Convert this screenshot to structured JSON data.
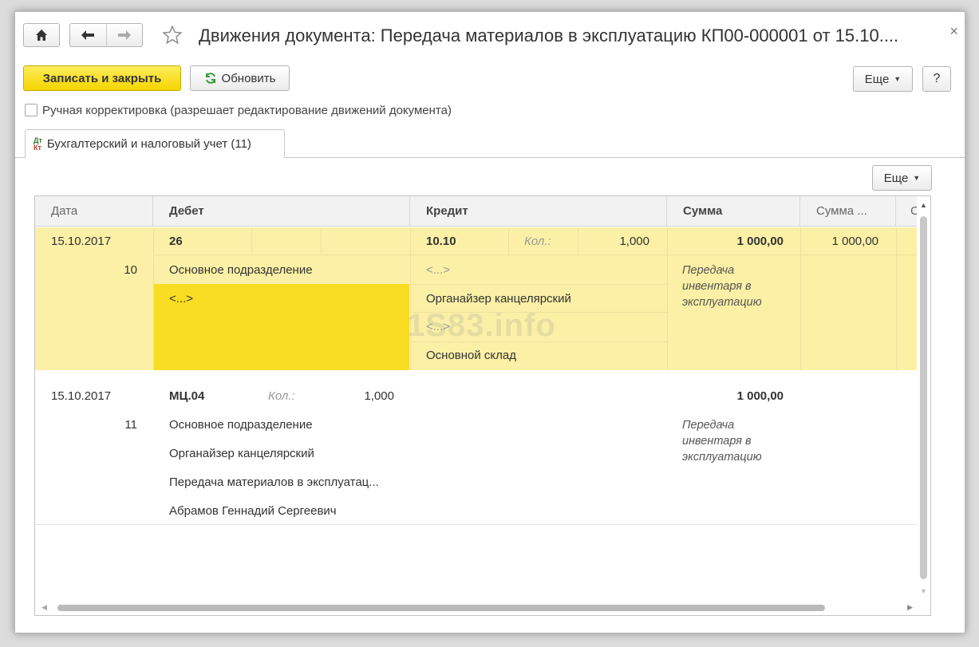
{
  "window": {
    "title": "Движения документа: Передача материалов в эксплуатацию КП00-000001 от 15.10....",
    "close_glyph": "×"
  },
  "toolbar": {
    "save_close_label": "Записать и закрыть",
    "refresh_label": "Обновить",
    "more_label": "Еще",
    "help_label": "?"
  },
  "manual_edit": {
    "label": "Ручная корректировка (разрешает редактирование движений документа)",
    "checked": false
  },
  "tabs": [
    {
      "label": "Бухгалтерский и налоговый учет (11)",
      "icon": "dt-kt-icon",
      "icon_top": "Дт",
      "icon_bottom": "Кт"
    }
  ],
  "panel": {
    "more_label": "Еще"
  },
  "table": {
    "columns": [
      "Дата",
      "Дебет",
      "Кредит",
      "Сумма",
      "Сумма ...",
      "С"
    ],
    "rows": [
      {
        "date": "15.10.2017",
        "line_no": "10",
        "debit_account": "26",
        "debit_subconto": [
          "Основное подразделение",
          "<...>"
        ],
        "credit_account": "10.10",
        "credit_qty_label": "Кол.:",
        "credit_qty": "1,000",
        "credit_subconto": [
          "<...>",
          "Органайзер канцелярский",
          "<...>",
          "Основной склад"
        ],
        "amount": "1 000,00",
        "amount2": "1 000,00",
        "content": "Передача инвентаря в эксплуатацию",
        "selected": true
      },
      {
        "date": "15.10.2017",
        "line_no": "11",
        "debit_account": "МЦ.04",
        "debit_qty_label": "Кол.:",
        "debit_qty": "1,000",
        "debit_subconto": [
          "Основное подразделение",
          "Органайзер канцелярский",
          "Передача материалов в эксплуатац...",
          "Абрамов Геннадий Сергеевич"
        ],
        "amount": "1 000,00",
        "content": "Передача инвентаря в эксплуатацию",
        "selected": false
      }
    ]
  },
  "watermark": "1S83.info",
  "colors": {
    "primary_button": "#f5d500",
    "selected_row": "#fbf0a6",
    "active_cell": "#f9dd22"
  }
}
